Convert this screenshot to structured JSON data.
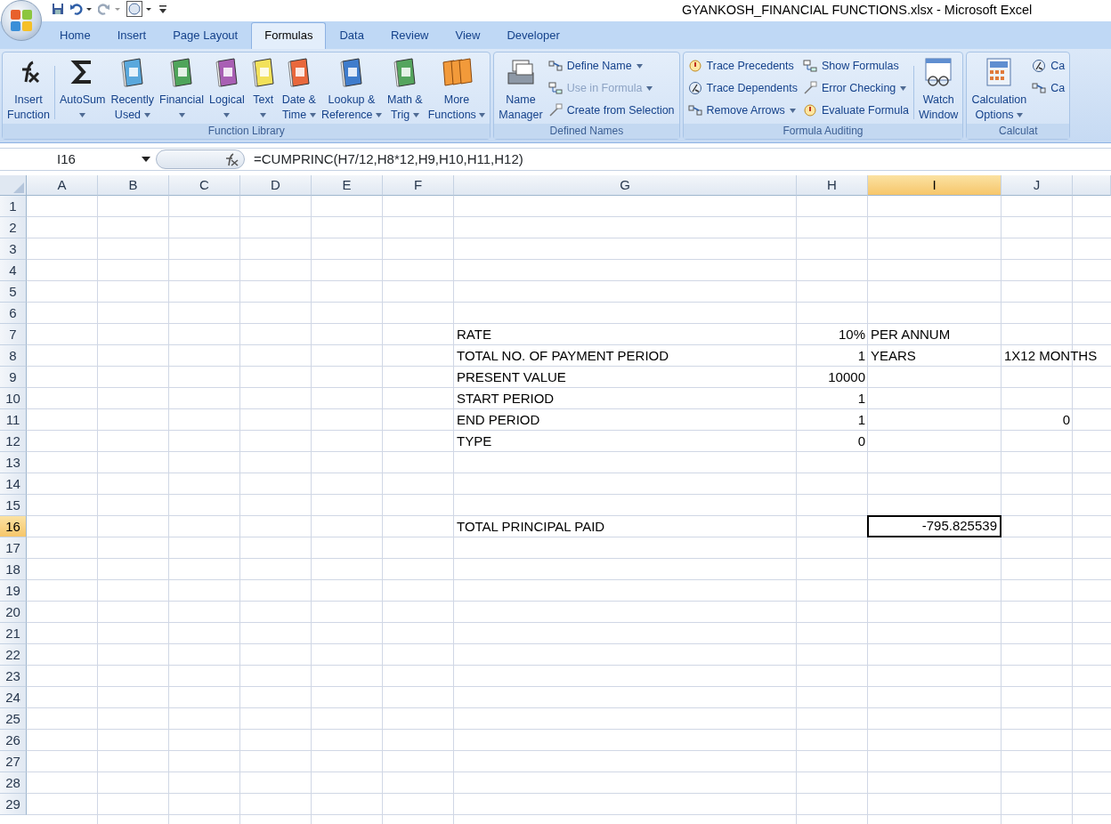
{
  "window": {
    "title": "GYANKOSH_FINANCIAL FUNCTIONS.xlsx - Microsoft Excel"
  },
  "tabs": [
    {
      "label": "Home",
      "selected": false
    },
    {
      "label": "Insert",
      "selected": false
    },
    {
      "label": "Page Layout",
      "selected": false
    },
    {
      "label": "Formulas",
      "selected": true
    },
    {
      "label": "Data",
      "selected": false
    },
    {
      "label": "Review",
      "selected": false
    },
    {
      "label": "View",
      "selected": false
    },
    {
      "label": "Developer",
      "selected": false
    }
  ],
  "ribbon": {
    "groups": [
      {
        "label": "Function Library",
        "items": [
          {
            "kind": "fx",
            "label": [
              "Insert",
              "Function"
            ],
            "dropdown": false
          },
          {
            "kind": "separator"
          },
          {
            "kind": "sigma",
            "label": [
              "AutoSum"
            ],
            "dropdown": true
          },
          {
            "kind": "book",
            "color": "#5aa8dc",
            "label": [
              "Recently",
              "Used"
            ],
            "dropdown": true
          },
          {
            "kind": "book",
            "color": "#4fa45a",
            "label": [
              "Financial"
            ],
            "dropdown": true
          },
          {
            "kind": "book",
            "color": "#a95fb4",
            "label": [
              "Logical"
            ],
            "dropdown": true
          },
          {
            "kind": "book",
            "color": "#f2e15a",
            "label": [
              "Text"
            ],
            "dropdown": true
          },
          {
            "kind": "book",
            "color": "#e9683c",
            "label": [
              "Date &",
              "Time"
            ],
            "dropdown": true
          },
          {
            "kind": "book",
            "color": "#3f7ccc",
            "label": [
              "Lookup &",
              "Reference"
            ],
            "dropdown": true
          },
          {
            "kind": "book",
            "color": "#55a55e",
            "label": [
              "Math &",
              "Trig"
            ],
            "dropdown": true
          },
          {
            "kind": "books",
            "color": "#f29a3a",
            "label": [
              "More",
              "Functions"
            ],
            "dropdown": true
          }
        ]
      },
      {
        "label": "Defined Names",
        "items": [
          {
            "kind": "cardfile",
            "label": [
              "Name",
              "Manager"
            ],
            "dropdown": false
          },
          {
            "kind": "stack",
            "buttons": [
              {
                "label": "Define Name",
                "dropdown": true,
                "disabled": false
              },
              {
                "label": "Use in Formula",
                "dropdown": true,
                "disabled": true
              },
              {
                "label": "Create from Selection",
                "dropdown": false,
                "disabled": false
              }
            ]
          }
        ]
      },
      {
        "label": "Formula Auditing",
        "items": [
          {
            "kind": "stack",
            "buttons": [
              {
                "label": "Trace Precedents",
                "dropdown": false,
                "disabled": false
              },
              {
                "label": "Trace Dependents",
                "dropdown": false,
                "disabled": false
              },
              {
                "label": "Remove Arrows",
                "dropdown": true,
                "disabled": false
              }
            ]
          },
          {
            "kind": "stack",
            "buttons": [
              {
                "label": "Show Formulas",
                "dropdown": false,
                "disabled": false
              },
              {
                "label": "Error Checking",
                "dropdown": true,
                "disabled": false
              },
              {
                "label": "Evaluate Formula",
                "dropdown": false,
                "disabled": false
              }
            ]
          },
          {
            "kind": "separator"
          },
          {
            "kind": "watch",
            "label": [
              "Watch",
              "Window"
            ],
            "dropdown": false
          }
        ]
      },
      {
        "label": "Calculat",
        "items": [
          {
            "kind": "calculator",
            "label": [
              "Calculation",
              "Options"
            ],
            "dropdown": true
          },
          {
            "kind": "stack",
            "buttons": [
              {
                "label": "Ca",
                "dropdown": false,
                "disabled": false
              },
              {
                "label": "Ca",
                "dropdown": false,
                "disabled": false
              }
            ]
          }
        ]
      }
    ]
  },
  "formula_bar": {
    "name_box": "I16",
    "formula": "=CUMPRINC(H7/12,H8*12,H9,H10,H11,H12)"
  },
  "grid": {
    "columns": [
      {
        "label": "A",
        "selected": false
      },
      {
        "label": "B",
        "selected": false
      },
      {
        "label": "C",
        "selected": false
      },
      {
        "label": "D",
        "selected": false
      },
      {
        "label": "E",
        "selected": false
      },
      {
        "label": "F",
        "selected": false
      },
      {
        "label": "G",
        "selected": false
      },
      {
        "label": "H",
        "selected": false
      },
      {
        "label": "I",
        "selected": true
      },
      {
        "label": "J",
        "selected": false
      }
    ],
    "rows": [
      {
        "label": "1",
        "selected": false
      },
      {
        "label": "2",
        "selected": false
      },
      {
        "label": "3",
        "selected": false
      },
      {
        "label": "4",
        "selected": false
      },
      {
        "label": "5",
        "selected": false
      },
      {
        "label": "6",
        "selected": false
      },
      {
        "label": "7",
        "selected": false,
        "cells": [
          null,
          null,
          null,
          null,
          null,
          null,
          {
            "kind": "text",
            "text": "RATE"
          },
          {
            "kind": "number",
            "text": "10%"
          },
          {
            "kind": "text",
            "text": "PER ANNUM"
          },
          null
        ]
      },
      {
        "label": "8",
        "selected": false,
        "cells": [
          null,
          null,
          null,
          null,
          null,
          null,
          {
            "kind": "text",
            "text": "TOTAL NO. OF PAYMENT PERIOD"
          },
          {
            "kind": "number",
            "text": "1"
          },
          {
            "kind": "text",
            "text": "YEARS"
          },
          {
            "kind": "text",
            "text": "1X12 MONTHS"
          }
        ]
      },
      {
        "label": "9",
        "selected": false,
        "cells": [
          null,
          null,
          null,
          null,
          null,
          null,
          {
            "kind": "text",
            "text": "PRESENT VALUE"
          },
          {
            "kind": "number",
            "text": "10000"
          },
          null,
          null
        ]
      },
      {
        "label": "10",
        "selected": false,
        "cells": [
          null,
          null,
          null,
          null,
          null,
          null,
          {
            "kind": "text",
            "text": "START PERIOD"
          },
          {
            "kind": "number",
            "text": "1"
          },
          null,
          null
        ]
      },
      {
        "label": "11",
        "selected": false,
        "cells": [
          null,
          null,
          null,
          null,
          null,
          null,
          {
            "kind": "text",
            "text": "END PERIOD"
          },
          {
            "kind": "number",
            "text": "1"
          },
          null,
          {
            "kind": "number",
            "text": "0"
          }
        ]
      },
      {
        "label": "12",
        "selected": false,
        "cells": [
          null,
          null,
          null,
          null,
          null,
          null,
          {
            "kind": "text",
            "text": "TYPE"
          },
          {
            "kind": "number",
            "text": "0"
          },
          null,
          null
        ]
      },
      {
        "label": "13",
        "selected": false
      },
      {
        "label": "14",
        "selected": false
      },
      {
        "label": "15",
        "selected": false
      },
      {
        "label": "16",
        "selected": true,
        "cells": [
          null,
          null,
          null,
          null,
          null,
          null,
          {
            "kind": "text",
            "text": "TOTAL PRINCIPAL PAID"
          },
          null,
          {
            "kind": "number",
            "text": "-795.825539"
          },
          null
        ]
      },
      {
        "label": "17",
        "selected": false
      },
      {
        "label": "18",
        "selected": false
      },
      {
        "label": "19",
        "selected": false
      },
      {
        "label": "20",
        "selected": false
      },
      {
        "label": "21",
        "selected": false
      },
      {
        "label": "22",
        "selected": false
      },
      {
        "label": "23",
        "selected": false
      },
      {
        "label": "24",
        "selected": false
      },
      {
        "label": "25",
        "selected": false
      },
      {
        "label": "26",
        "selected": false
      },
      {
        "label": "27",
        "selected": false
      },
      {
        "label": "28",
        "selected": false
      },
      {
        "label": "29",
        "selected": false
      }
    ]
  }
}
